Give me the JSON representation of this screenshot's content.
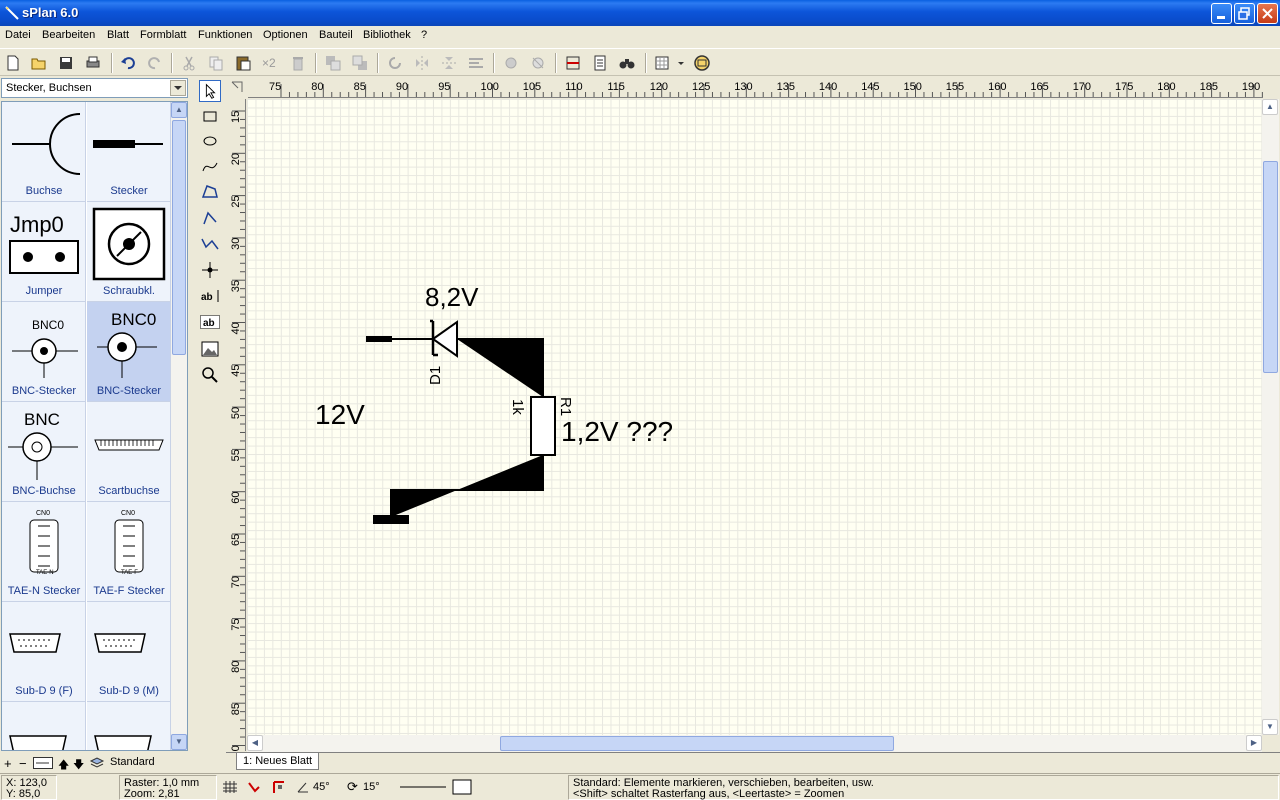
{
  "window": {
    "title": "sPlan 6.0",
    "accent": "#0A4CCB"
  },
  "menu": [
    "Datei",
    "Bearbeiten",
    "Blatt",
    "Formblatt",
    "Funktionen",
    "Optionen",
    "Bauteil",
    "Bibliothek",
    "?"
  ],
  "toolbar": {
    "icons": [
      "new-file-icon",
      "open-icon",
      "save-icon",
      "print-icon",
      "undo-icon",
      "redo-icon",
      "cut-icon",
      "copy-icon",
      "paste-icon",
      "duplicate-icon",
      "delete-icon",
      "to-front-icon",
      "to-back-icon",
      "rotate-icon",
      "mirror-h-icon",
      "mirror-v-icon",
      "align-icon",
      "group-icon",
      "ungroup-icon",
      "snap-icon",
      "bom-icon",
      "find-icon",
      "grid-icon",
      "zoom-icon"
    ],
    "duplicate_label": "×2"
  },
  "library": {
    "selected": "Stecker, Buchsen",
    "items": [
      {
        "label": "Buchse"
      },
      {
        "label": "Stecker"
      },
      {
        "label": "Jumper",
        "symbol_text": "Jmp0"
      },
      {
        "label": "Schraubkl."
      },
      {
        "label": "BNC-Stecker",
        "symbol_text": "BNC0"
      },
      {
        "label": "BNC-Stecker",
        "symbol_text": "BNC0",
        "selected": true
      },
      {
        "label": "BNC-Buchse",
        "symbol_text": "BNC"
      },
      {
        "label": "Scartbuchse"
      },
      {
        "label": "TAE-N Stecker",
        "symbol_text": "CN0",
        "sub_text": "TAE-N"
      },
      {
        "label": "TAE-F Stecker",
        "symbol_text": "CN0",
        "sub_text": "TAE-F"
      },
      {
        "label": "Sub-D 9 (F)"
      },
      {
        "label": "Sub-D 9 (M)"
      }
    ],
    "bottom_label": "Standard"
  },
  "tools": [
    "pointer-tool-icon",
    "rectangle-tool-icon",
    "ellipse-tool-icon",
    "freehand-tool-icon",
    "polygon-tool-icon",
    "line-tool-icon",
    "bezier-tool-icon",
    "junction-tool-icon",
    "text-tool-icon",
    "textbox-tool-icon",
    "image-tool-icon",
    "zoom-tool-icon"
  ],
  "ruler": {
    "top": [
      "75",
      "80",
      "85",
      "90",
      "95",
      "100",
      "105",
      "110",
      "115",
      "120",
      "125",
      "130",
      "135",
      "140",
      "145",
      "150",
      "155",
      "160",
      "165",
      "170",
      "175",
      "180",
      "185",
      "190"
    ],
    "left": [
      "15",
      "20",
      "25",
      "30",
      "35",
      "40",
      "45",
      "50",
      "55",
      "60",
      "65",
      "70",
      "75",
      "80",
      "85",
      "90"
    ]
  },
  "schematic": {
    "texts": {
      "zener_value": "8,2V",
      "zener_ref": "D1",
      "input_label": "12V",
      "res_value": "1k",
      "res_ref": "R1",
      "output_label": "1,2V ???"
    }
  },
  "sheet_tab": "1: Neues Blatt",
  "status": {
    "x": "X: 123,0",
    "y": "Y: 85,0",
    "raster": "Raster: 1,0 mm",
    "zoom": "Zoom:   2,81",
    "angle1": "45°",
    "angle2": "15°",
    "hint1": "Standard: Elemente markieren, verschieben, bearbeiten, usw.",
    "hint2": "<Shift> schaltet Rasterfang aus, <Leertaste> = Zoomen"
  }
}
